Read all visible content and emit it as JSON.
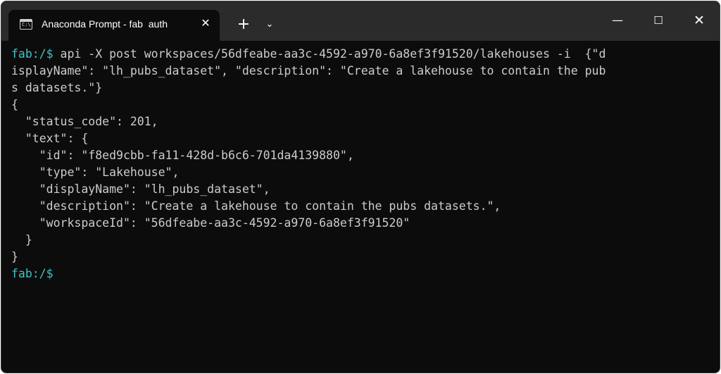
{
  "window": {
    "tab_title": "Anaconda Prompt - fab  auth",
    "tab_icon": "terminal-icon",
    "tab_close_glyph": "✕",
    "new_tab_glyph": "+",
    "dropdown_glyph": "⌄",
    "minimize_glyph": "—",
    "maximize_glyph": "☐",
    "close_glyph": "✕"
  },
  "terminal": {
    "prompt": "fab:/$",
    "command_lines": [
      " api -X post workspaces/56dfeabe-aa3c-4592-a970-6a8ef3f91520/lakehouses -i  {\"d",
      "isplayName\": \"lh_pubs_dataset\", \"description\": \"Create a lakehouse to contain the pub",
      "s datasets.\"}"
    ],
    "output_lines": [
      "{",
      "  \"status_code\": 201,",
      "  \"text\": {",
      "    \"id\": \"f8ed9cbb-fa11-428d-b6c6-701da4139880\",",
      "    \"type\": \"Lakehouse\",",
      "    \"displayName\": \"lh_pubs_dataset\",",
      "    \"description\": \"Create a lakehouse to contain the pubs datasets.\",",
      "    \"workspaceId\": \"56dfeabe-aa3c-4592-a970-6a8ef3f91520\"",
      "  }",
      "}"
    ],
    "final_prompt": "fab:/$",
    "colors": {
      "background": "#0c0c0c",
      "text": "#cccccc",
      "prompt": "#3fc4c8",
      "titlebar": "#2b2b2b"
    }
  }
}
